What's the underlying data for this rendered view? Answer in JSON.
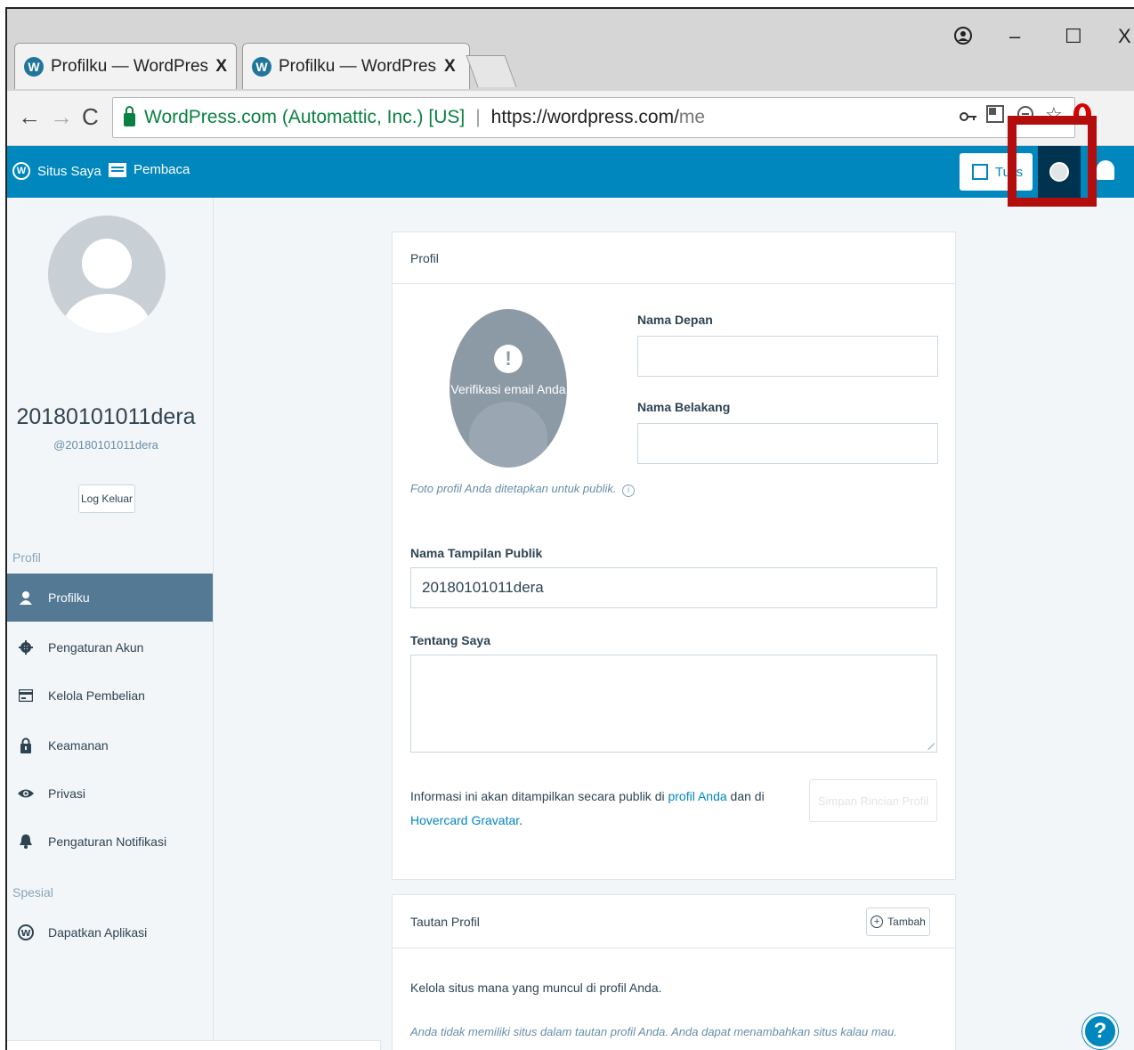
{
  "browser": {
    "tabs": [
      {
        "title": "Profilku — WordPress.com",
        "close": "X"
      },
      {
        "title": "Profilku — WordPress.com",
        "close": "X"
      }
    ],
    "window": {
      "minimize": "–",
      "maximize": "☐",
      "close": "X"
    },
    "nav": {
      "back": "←",
      "forward": "→",
      "reload": "C"
    },
    "address": {
      "origin": "WordPress.com (Automattic, Inc.) [US]",
      "separator": "|",
      "host": "https://wordpress.com/",
      "path": "me"
    }
  },
  "masterbar": {
    "my_sites": "Situs Saya",
    "reader": "Pembaca",
    "write": "Tulis"
  },
  "sidebar": {
    "display_name": "20180101011dera",
    "username": "@20180101011dera",
    "logout": "Log Keluar",
    "section_profile": "Profil",
    "items": [
      {
        "label": "Profilku",
        "icon": "user-icon"
      },
      {
        "label": "Pengaturan Akun",
        "icon": "gear-icon"
      },
      {
        "label": "Kelola Pembelian",
        "icon": "credit-card-icon"
      },
      {
        "label": "Keamanan",
        "icon": "lock-icon"
      },
      {
        "label": "Privasi",
        "icon": "eye-icon"
      },
      {
        "label": "Pengaturan Notifikasi",
        "icon": "bell-icon"
      }
    ],
    "section_special": "Spesial",
    "special_items": [
      {
        "label": "Dapatkan Aplikasi",
        "icon": "wordpress-icon"
      }
    ]
  },
  "profile_card": {
    "header": "Profil",
    "verify_badge": "!",
    "verify_text": "Verifikasi email Anda",
    "photo_note": "Foto profil Anda ditetapkan untuk publik.",
    "info_glyph": "i",
    "first_name_label": "Nama Depan",
    "first_name_value": "",
    "last_name_label": "Nama Belakang",
    "last_name_value": "",
    "display_name_label": "Nama Tampilan Publik",
    "display_name_value": "20180101011dera",
    "about_label": "Tentang Saya",
    "about_value": "",
    "info_part1": "Informasi ini akan ditampilkan secara publik di ",
    "info_link1": "profil Anda",
    "info_part2": " dan di ",
    "info_link2": "Hovercard Gravatar",
    "info_part3": ".",
    "save_button": "Simpan Rincian Profil"
  },
  "links_card": {
    "header": "Tautan Profil",
    "add_symbol": "+",
    "add_button": "Tambah",
    "manage_text": "Kelola situs mana yang muncul di profil Anda.",
    "empty_text": "Anda tidak memiliki situs dalam tautan profil Anda. Anda dapat menambahkan situs kalau mau."
  },
  "help": {
    "symbol": "?"
  },
  "colors": {
    "masterbar": "#0087be",
    "active_item": "#537994",
    "highlight": "#b30d0d"
  }
}
